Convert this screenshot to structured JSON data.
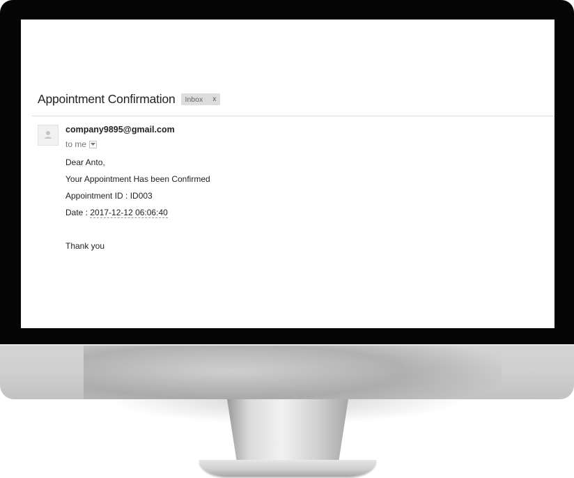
{
  "email": {
    "subject": "Appointment Confirmation",
    "label": "Inbox",
    "label_close": "x",
    "sender": "company9895@gmail.com",
    "recipient": "to me",
    "body": {
      "greeting": "Dear Anto,",
      "message": "Your Appointment Has been Confirmed",
      "appointment_id": "Appointment ID : ID003",
      "date_prefix": "Date : ",
      "date_value": "2017-12-12 06:06:40",
      "closing": "Thank you"
    }
  },
  "icons": {
    "avatar": "default-user-icon",
    "details_toggle": "caret-down-icon"
  },
  "colors": {
    "bezel": "#050505",
    "label_chip": "#dddddd",
    "text": "#222222"
  }
}
